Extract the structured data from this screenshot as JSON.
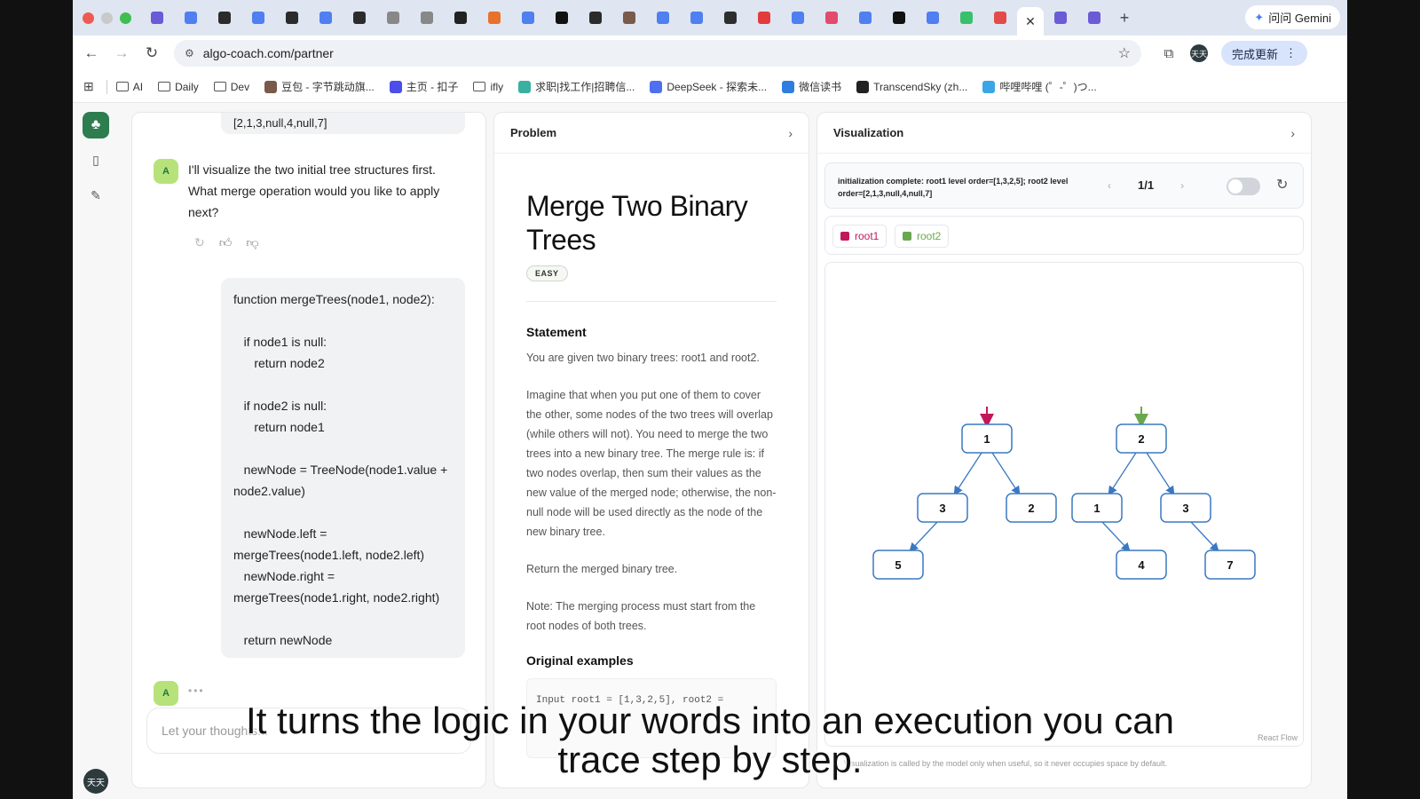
{
  "browser": {
    "url": "algo-coach.com/partner",
    "gemini_label": "问问 Gemini",
    "update_label": "完成更新",
    "profile_initials": "天天",
    "tab_colors": [
      "#6b5bd6",
      "#4f7ff0",
      "#2b2b2b",
      "#4f7ff0",
      "#2b2b2b",
      "#4f7ff0",
      "#2b2b2b",
      "#888888",
      "#888888",
      "#222222",
      "#e8712b",
      "#4f7ff0",
      "#111111",
      "#2b2b2b",
      "#7a5a4a",
      "#4f7ff0",
      "#4f7ff0",
      "#2e2e2e",
      "#e33b3b",
      "#4f7ff0",
      "#e34b6b",
      "#4f7ff0",
      "#111111",
      "#4f7ff0",
      "#39c06a",
      "#e34b4b",
      "#6b5bd6",
      "#6b5bd6"
    ],
    "bookmarks": [
      {
        "label": "AI",
        "type": "folder"
      },
      {
        "label": "Daily",
        "type": "folder"
      },
      {
        "label": "Dev",
        "type": "folder"
      },
      {
        "label": "豆包 - 字节跳动旗...",
        "type": "site",
        "color": "#7a5a4a"
      },
      {
        "label": "主页 - 扣子",
        "type": "site",
        "color": "#4b4ee8"
      },
      {
        "label": "ifly",
        "type": "folder"
      },
      {
        "label": "求职|找工作|招聘信...",
        "type": "site",
        "color": "#39b0a0"
      },
      {
        "label": "DeepSeek - 探索未...",
        "type": "site",
        "color": "#4f6ef0"
      },
      {
        "label": "微信读书",
        "type": "site",
        "color": "#2f7de0"
      },
      {
        "label": "TranscendSky (zh...",
        "type": "site",
        "color": "#222222"
      },
      {
        "label": "哔哩哔哩 (゜-゜)つ...",
        "type": "site",
        "color": "#3aa6e8"
      }
    ]
  },
  "chat": {
    "prev_bubble_text": "[2,1,3,null,4,null,7]",
    "assistant_initial": "A",
    "assistant_message": "I'll visualize the two initial tree structures first. What merge operation would you like to apply next?",
    "code_lines": [
      "function mergeTrees(node1, node2):",
      "",
      "   if node1 is null:",
      "      return node2",
      "",
      "   if node2 is null:",
      "      return node1",
      "",
      "   newNode = TreeNode(node1.value + node2.value)",
      "",
      "   newNode.left = mergeTrees(node1.left, node2.left)",
      "   newNode.right = mergeTrees(node1.right, node2.right)",
      "",
      "   return newNode"
    ],
    "input_placeholder": "Let your thoughts..."
  },
  "problem": {
    "header": "Problem",
    "title": "Merge Two Binary Trees",
    "difficulty": "EASY",
    "statement_heading": "Statement",
    "paragraphs": [
      "You are given two binary trees: root1 and root2.",
      "Imagine that when you put one of them to cover the other, some nodes of the two trees will overlap (while others will not). You need to merge the two trees into a new binary tree. The merge rule is: if two nodes overlap, then sum their values as the new value of the merged node; otherwise, the non-null node will be used directly as the node of the new binary tree.",
      "Return the merged binary tree.",
      "Note: The merging process must start from the root nodes of both trees."
    ],
    "examples_heading": "Original examples",
    "example_snippet": "Input   root1 = [1,3,2,5], root2 ="
  },
  "visualization": {
    "header": "Visualization",
    "step_description": "initialization complete: root1 level order=[1,3,2,5]; root2 level order=[2,1,3,null,4,null,7]",
    "step_counter": "1/1",
    "legend": [
      {
        "name": "root1",
        "color": "#c2185b"
      },
      {
        "name": "root2",
        "color": "#6aa84f"
      }
    ],
    "trees": [
      {
        "name": "root1",
        "color": "#c2185b",
        "nodes": [
          1,
          3,
          2,
          5,
          null,
          null,
          null
        ]
      },
      {
        "name": "root2",
        "color": "#6aa84f",
        "nodes": [
          2,
          1,
          3,
          null,
          4,
          null,
          7
        ]
      }
    ],
    "react_flow_label": "React Flow",
    "footnote": "Visualization is called by the model only when useful, so it never occupies space by default.",
    "node_border_color": "#3a78c2"
  },
  "caption": {
    "line1": "It turns the logic in your words into an execution you can",
    "line2": "trace step by step."
  }
}
